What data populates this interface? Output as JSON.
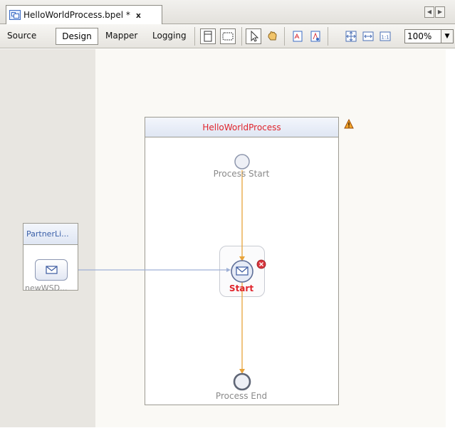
{
  "editor_tab": {
    "title": "HelloWorldProcess.bpel *",
    "close": "x",
    "nav_left": "◀",
    "nav_right": "▶"
  },
  "toolbar": {
    "views": [
      "Source",
      "Design",
      "Mapper",
      "Logging"
    ],
    "active_view": "Design",
    "zoom": "100%",
    "zoom_arrow": "▼"
  },
  "diagram": {
    "process_title": "HelloWorldProcess",
    "start_node_label": "Process Start",
    "receive_label": "Start",
    "end_node_label": "Process End",
    "partner_link_title": "PartnerLi...",
    "partner_port_label": "newWSD..."
  },
  "colors": {
    "flow_line": "#e8a33a",
    "link_line": "#9fb1d6",
    "error_badge": "#d9363e",
    "process_title": "#e0242c",
    "partner_title": "#3a5fa8"
  },
  "icons": {
    "tab": "bpel-file-icon",
    "warning": "warning-icon",
    "error": "error-badge-icon",
    "message": "envelope-icon"
  }
}
